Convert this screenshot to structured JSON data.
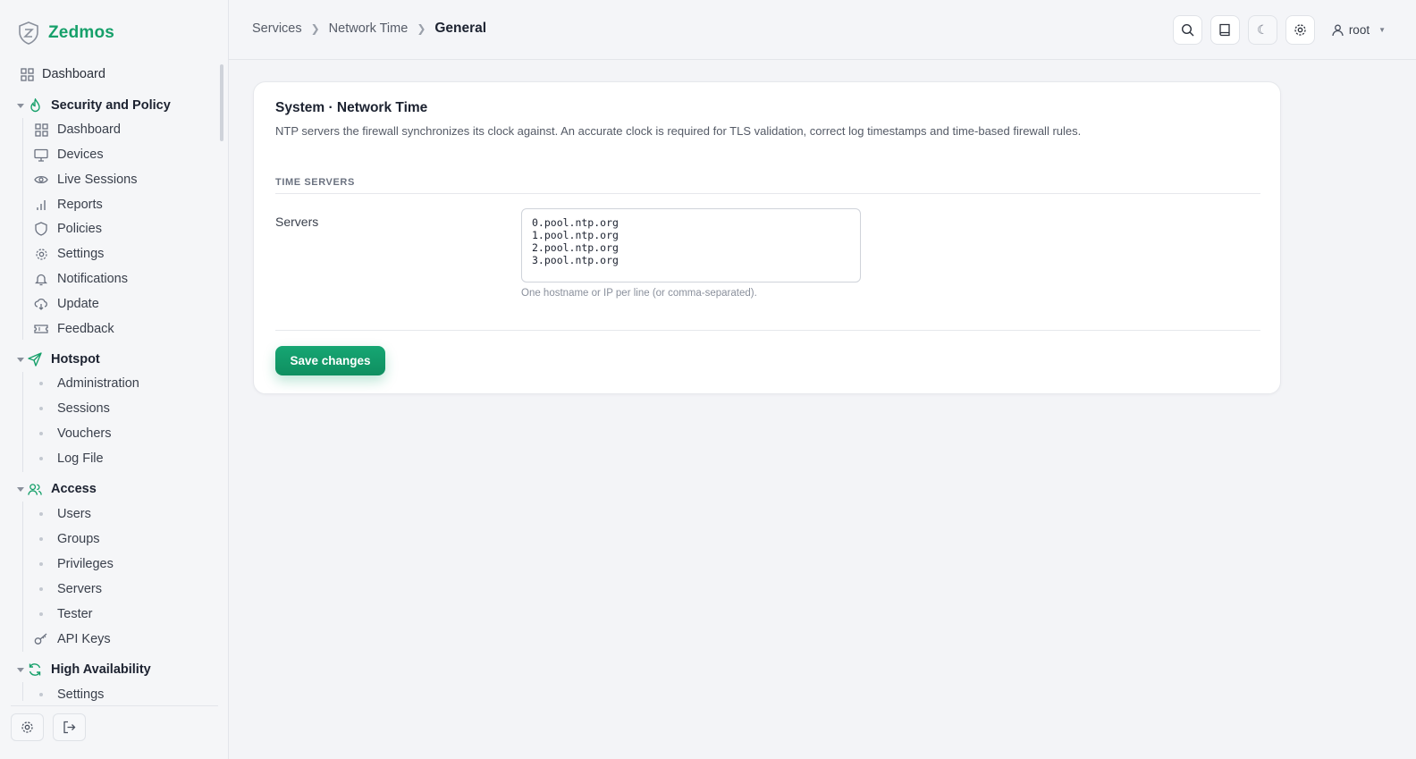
{
  "brand": {
    "name": "Zedmos"
  },
  "sidebar": {
    "top": {
      "label": "Dashboard",
      "icon": "grid-icon"
    },
    "sections": [
      {
        "label": "Security and Policy",
        "icon": "flame-icon",
        "items": [
          {
            "label": "Dashboard",
            "icon": "grid-icon"
          },
          {
            "label": "Devices",
            "icon": "monitor-icon"
          },
          {
            "label": "Live Sessions",
            "icon": "eye-icon"
          },
          {
            "label": "Reports",
            "icon": "bar-chart-icon"
          },
          {
            "label": "Policies",
            "icon": "shield-icon"
          },
          {
            "label": "Settings",
            "icon": "gear-icon"
          },
          {
            "label": "Notifications",
            "icon": "bell-icon"
          },
          {
            "label": "Update",
            "icon": "cloud-download-icon"
          },
          {
            "label": "Feedback",
            "icon": "ticket-icon"
          }
        ]
      },
      {
        "label": "Hotspot",
        "icon": "send-icon",
        "items": [
          {
            "label": "Administration"
          },
          {
            "label": "Sessions"
          },
          {
            "label": "Vouchers"
          },
          {
            "label": "Log File"
          }
        ]
      },
      {
        "label": "Access",
        "icon": "users-icon",
        "items": [
          {
            "label": "Users"
          },
          {
            "label": "Groups"
          },
          {
            "label": "Privileges"
          },
          {
            "label": "Servers"
          },
          {
            "label": "Tester"
          },
          {
            "label": "API Keys",
            "icon": "key-icon"
          }
        ]
      },
      {
        "label": "High Availability",
        "icon": "refresh-icon",
        "items": [
          {
            "label": "Settings"
          }
        ]
      }
    ]
  },
  "breadcrumb": [
    "Services",
    "Network Time",
    "General"
  ],
  "user": {
    "name": "root"
  },
  "card": {
    "title": "System · Network Time",
    "description": "NTP servers the firewall synchronizes its clock against. An accurate clock is required for TLS validation, correct log timestamps and time-based firewall rules.",
    "section_title": "TIME SERVERS",
    "servers_label": "Servers",
    "servers_value": "0.pool.ntp.org\n1.pool.ntp.org\n2.pool.ntp.org\n3.pool.ntp.org",
    "help": "One hostname or IP per line (or comma-separated).",
    "save_label": "Save changes"
  },
  "colors": {
    "accent": "#16a06a",
    "text": "#1c2230",
    "muted": "#6b7280"
  }
}
